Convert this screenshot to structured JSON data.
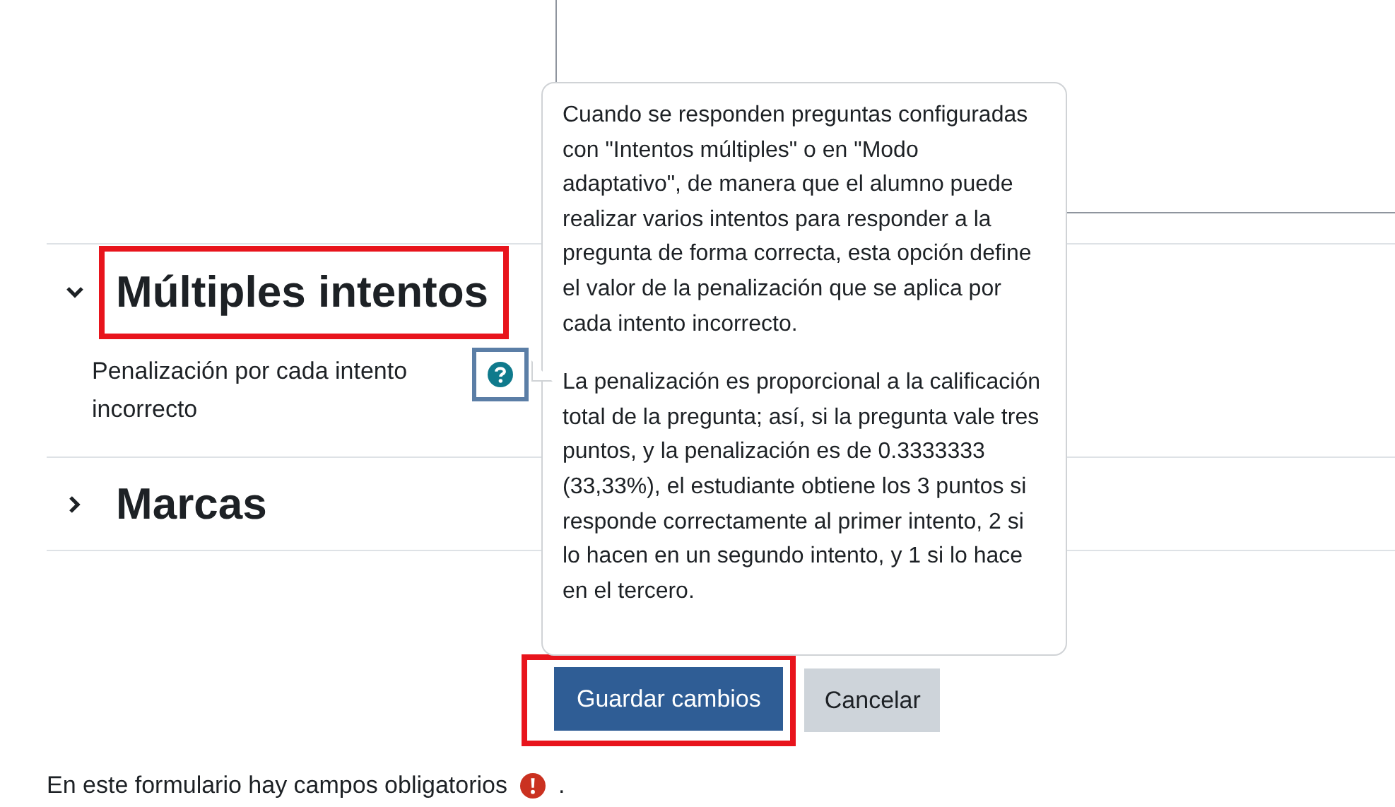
{
  "sections": [
    {
      "title": "Múltiples intentos",
      "expanded": true,
      "highlighted": true,
      "fields": [
        {
          "label": "Penalización por cada intento incorrecto",
          "help_highlighted": true
        }
      ]
    },
    {
      "title": "Marcas",
      "expanded": false,
      "highlighted": false
    }
  ],
  "help_popover": {
    "paragraphs": [
      "Cuando se responden preguntas configuradas con \"Intentos múltiples\" o en \"Modo adaptativo\", de manera que el alumno puede realizar varios intentos para responder a la pregunta de forma correcta, esta opción define el valor de la penalización que se aplica por cada intento incorrecto.",
      "La penalización es proporcional a la calificación total de la pregunta; así, si la pregunta vale tres puntos, y la penalización es de 0.3333333 (33,33%), el estudiante obtiene los 3 puntos si responde correctamente al primer intento, 2 si lo hacen en un segundo intento, y 1 si lo hace en el tercero."
    ]
  },
  "buttons": [
    {
      "label": "Guardar cambios",
      "kind": "primary",
      "highlighted": true
    },
    {
      "label": "Cancelar",
      "kind": "secondary",
      "highlighted": false
    }
  ],
  "required_note": {
    "text": "En este formulario hay campos obligatorios",
    "suffix": "."
  }
}
